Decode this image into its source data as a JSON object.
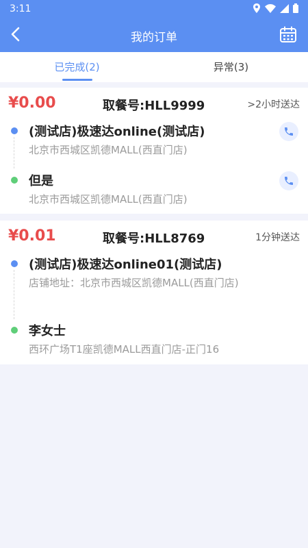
{
  "status_bar": {
    "time": "3:11"
  },
  "header": {
    "title": "我的订单"
  },
  "tabs": [
    {
      "label": "已完成(2)",
      "active": true
    },
    {
      "label": "异常(3)",
      "active": false
    }
  ],
  "orders": [
    {
      "price": "¥0.00",
      "pickup_code": "取餐号:HLL9999",
      "eta": ">2小时送达",
      "shop": {
        "name": "(测试店)极速达online(测试店)",
        "address": "北京市西城区凯德MALL(西直门店)"
      },
      "customer": {
        "name": "但是",
        "address": "北京市西城区凯德MALL(西直门店)"
      }
    },
    {
      "price": "¥0.01",
      "pickup_code": "取餐号:HLL8769",
      "eta": "1分钟送达",
      "shop": {
        "name": "(测试店)极速达online01(测试店)",
        "address": "店铺地址：北京市西城区凯德MALL(西直门店)"
      },
      "customer": {
        "name": "李女士",
        "address": "西环广场T1座凯德MALL西直门店-正门16"
      }
    }
  ],
  "colors": {
    "primary": "#5b8ff2",
    "price": "#e84c4c",
    "dot_shop": "#5b8ff2",
    "dot_customer": "#5fce79"
  }
}
